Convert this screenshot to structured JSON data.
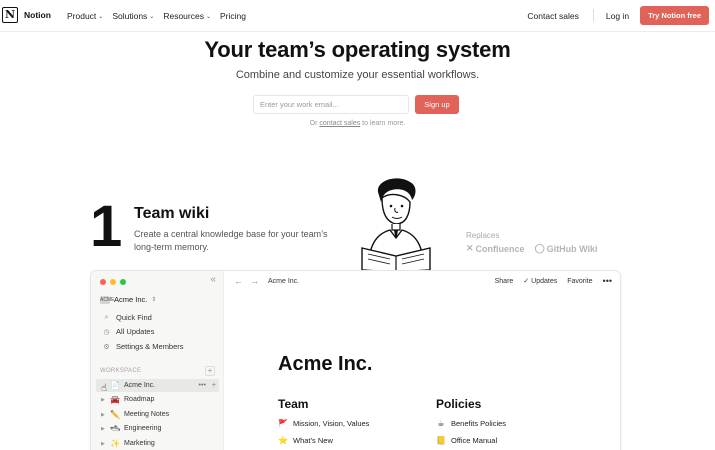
{
  "nav": {
    "logo_text": "Notion",
    "logo_mark": "N",
    "links": [
      {
        "label": "Product",
        "chevron": "⌄"
      },
      {
        "label": "Solutions",
        "chevron": "⌄"
      },
      {
        "label": "Resources",
        "chevron": "⌄"
      },
      {
        "label": "Pricing",
        "chevron": ""
      }
    ],
    "contact_sales": "Contact sales",
    "login": "Log in",
    "try_button": "Try Notion free"
  },
  "hero": {
    "title": "Your team’s operating system",
    "subtitle": "Combine and customize your essential workflows.",
    "email_placeholder": "Enter your work email...",
    "signup_button": "Sign up",
    "learn_prefix": "Or",
    "learn_link": "contact sales",
    "learn_suffix": "to learn more."
  },
  "section": {
    "number": "1",
    "title": "Team wiki",
    "description": "Create a central knowledge base for your team’s long-term memory.",
    "replaces_label": "Replaces",
    "replaces": [
      {
        "icon": "confluence-icon",
        "glyph": "✕",
        "label": "Confluence"
      },
      {
        "icon": "github-icon",
        "glyph": "◯",
        "label": "GitHub Wiki"
      }
    ]
  },
  "app": {
    "sidebar": {
      "collapse_glyph": "«",
      "workspace_name": "Acme Inc.",
      "workspace_chevron": "⇕",
      "workspace_avatar": "ACME",
      "quick_items": [
        {
          "icon": "search-icon",
          "glyph": "⌕",
          "label": "Quick Find"
        },
        {
          "icon": "clock-icon",
          "glyph": "◷",
          "label": "All Updates"
        },
        {
          "icon": "gear-icon",
          "glyph": "⚙",
          "label": "Settings & Members"
        }
      ],
      "workspace_label": "WORKSPACE",
      "add_glyph": "+",
      "tree": [
        {
          "emoji": "📄",
          "label": "Acme Inc.",
          "active": true
        },
        {
          "emoji": "🚘",
          "label": "Roadmap"
        },
        {
          "emoji": "✏️",
          "label": "Meeting Notes"
        },
        {
          "emoji": "🛥",
          "label": "Engineering"
        },
        {
          "emoji": "✨",
          "label": "Marketing"
        }
      ],
      "row_more": "•••",
      "row_add": "+"
    },
    "topbar": {
      "back": "←",
      "forward": "→",
      "breadcrumb": "Acme Inc.",
      "share": "Share",
      "updates_check": "✓",
      "updates": "Updates",
      "favorite": "Favorite",
      "more": "•••"
    },
    "page": {
      "title": "Acme Inc.",
      "columns": [
        {
          "heading": "Team",
          "items": [
            {
              "emoji": "🚩",
              "label": "Mission, Vision, Values"
            },
            {
              "emoji": "⭐",
              "label": "What’s New"
            }
          ]
        },
        {
          "heading": "Policies",
          "items": [
            {
              "emoji": "☕",
              "label": "Benefits Policies"
            },
            {
              "emoji": "📒",
              "label": "Office Manual"
            }
          ]
        }
      ]
    }
  },
  "colors": {
    "accent": "#e16259",
    "text": "#111111",
    "muted": "#9a9a9a",
    "sidebar_bg": "#f7f7f5"
  }
}
